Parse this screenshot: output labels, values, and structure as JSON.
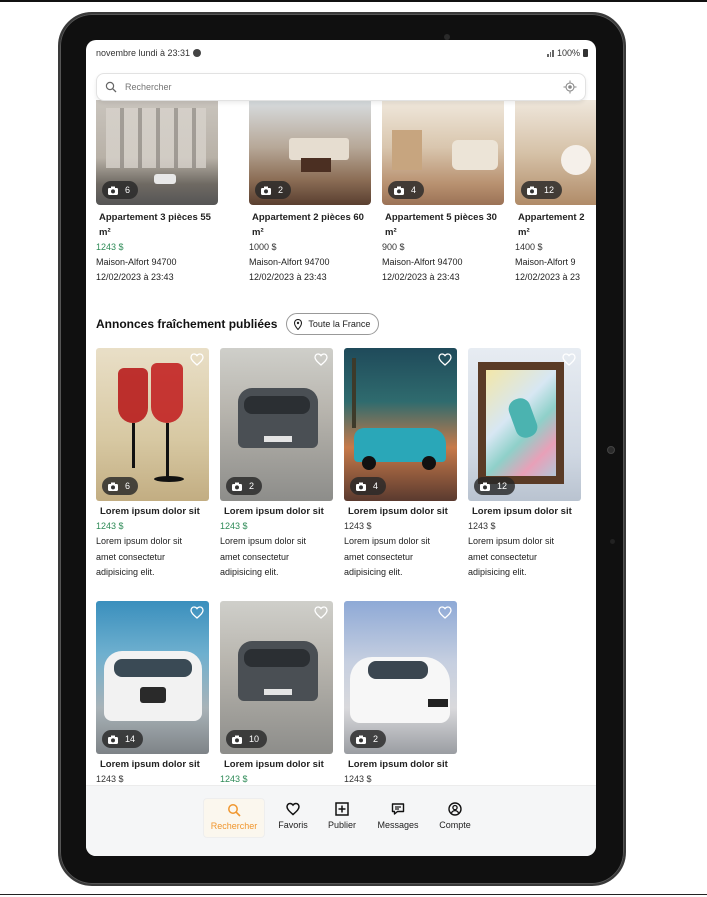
{
  "status_bar": {
    "time": "novembre lundi à 23:31",
    "battery": "100%"
  },
  "search": {
    "placeholder": "Rechercher"
  },
  "colors": {
    "accent": "#f0962e",
    "price_green": "#2e8b57"
  },
  "top_listings": [
    {
      "title": "Appartement 3 pièces 55 m²",
      "price": "1243 $",
      "location": "Maison-Alfort 94700",
      "date": "12/02/2023 à 23:43",
      "photos": "6"
    },
    {
      "title": "Appartement 2 pièces 60 m²",
      "price": "1000 $",
      "location": "Maison-Alfort 94700",
      "date": "12/02/2023 à 23:43",
      "photos": "2"
    },
    {
      "title": "Appartement 5 pièces 30 m²",
      "price": "900 $",
      "location": "Maison-Alfort 94700",
      "date": "12/02/2023 à 23:43",
      "photos": "4"
    },
    {
      "title": "Appartement 2",
      "title_cont": "m²",
      "price": "1400 $",
      "location": "Maison-Alfort 9",
      "date": "12/02/2023 à 23",
      "photos": "12"
    }
  ],
  "section": {
    "title": "Annonces fraîchement publiées",
    "filter_label": "Toute la France"
  },
  "fresh_listings": [
    {
      "title": "Lorem ipsum dolor sit",
      "price": "1243 $",
      "desc1": "Lorem ipsum dolor sit",
      "desc2": "amet consectetur",
      "desc3": "adipisicing elit.",
      "photos": "6"
    },
    {
      "title": "Lorem ipsum dolor sit",
      "price": "1243 $",
      "desc1": "Lorem ipsum dolor sit",
      "desc2": "amet consectetur",
      "desc3": "adipisicing elit.",
      "photos": "2"
    },
    {
      "title": "Lorem ipsum dolor sit",
      "price": "1243 $",
      "desc1": "Lorem ipsum dolor sit",
      "desc2": "amet consectetur",
      "desc3": "adipisicing elit.",
      "photos": "4"
    },
    {
      "title": "Lorem ipsum dolor sit",
      "price": "1243 $",
      "desc1": "Lorem ipsum dolor sit",
      "desc2": "amet consectetur",
      "desc3": "adipisicing elit.",
      "photos": "12"
    },
    {
      "title": "Lorem ipsum dolor sit",
      "price": "1243 $",
      "photos": "14"
    },
    {
      "title": "Lorem ipsum dolor sit",
      "price": "1243 $",
      "photos": "10"
    },
    {
      "title": "Lorem ipsum dolor sit",
      "price": "1243 $",
      "photos": "2"
    }
  ],
  "nav": {
    "search": "Rechercher",
    "favorites": "Favoris",
    "publish": "Publier",
    "messages": "Messages",
    "account": "Compte"
  }
}
